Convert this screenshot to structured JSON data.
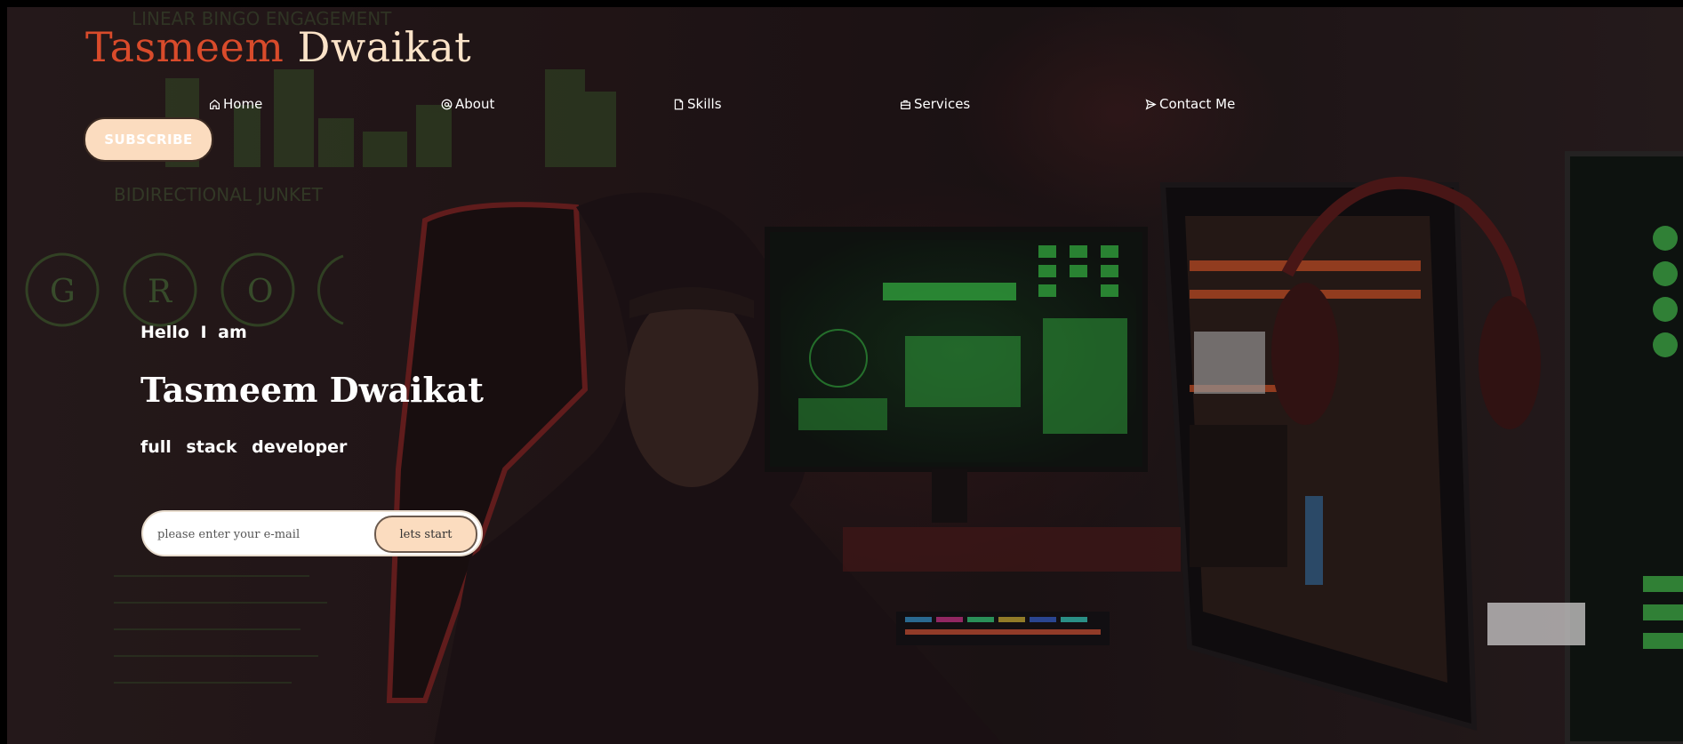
{
  "header": {
    "logo_first": "Tasmeem",
    "logo_last": "Dwaikat"
  },
  "nav": {
    "items": [
      {
        "label": "Home",
        "icon": "home-icon"
      },
      {
        "label": "About",
        "icon": "at-icon"
      },
      {
        "label": "Skills",
        "icon": "file-icon"
      },
      {
        "label": "Services",
        "icon": "briefcase-icon"
      },
      {
        "label": "Contact Me",
        "icon": "send-icon"
      }
    ]
  },
  "subscribe_label": "SUBSCRIBE",
  "hero": {
    "greeting": "Hello I am",
    "name": "Tasmeem Dwaikat",
    "role": "full stack developer"
  },
  "form": {
    "email_placeholder": "please enter your e-mail",
    "submit_label": "lets start"
  },
  "colors": {
    "logo_first": "#d94b2b",
    "logo_last": "#fbe3c8",
    "button_bg": "#fbdcbf"
  },
  "background": {
    "wall_letters": [
      "G",
      "R",
      "O"
    ],
    "wall_texts": [
      "LINEAR BINGO ENGAGEMENT",
      "BIDIRECTIONAL JUNKET"
    ]
  }
}
